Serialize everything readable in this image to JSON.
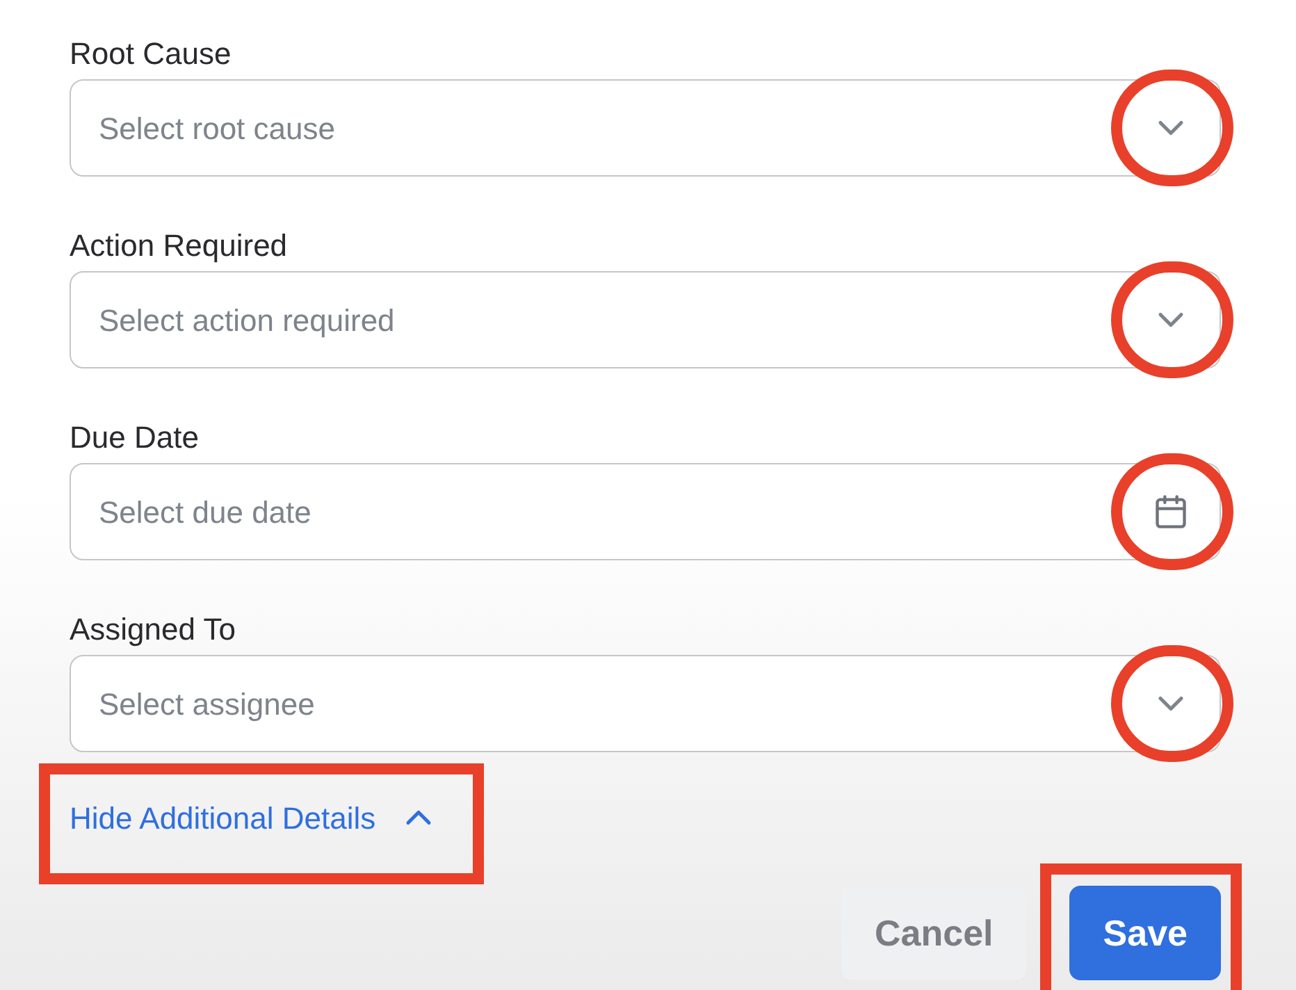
{
  "fields": [
    {
      "kind": "select",
      "label": "Root Cause",
      "placeholder": "Select root cause",
      "circled": true
    },
    {
      "kind": "select",
      "label": "Action Required",
      "placeholder": "Select action required",
      "circled": true
    },
    {
      "kind": "date",
      "label": "Due Date",
      "placeholder": "Select due date",
      "circled": true
    },
    {
      "kind": "select",
      "label": "Assigned To",
      "placeholder": "Select assignee",
      "circled": true
    }
  ],
  "details_toggle": {
    "label": "Hide Additional Details",
    "expanded": true,
    "boxed": true
  },
  "buttons": [
    {
      "kind": "secondary",
      "label": "Cancel"
    },
    {
      "kind": "primary",
      "label": "Save",
      "boxed": true
    }
  ]
}
